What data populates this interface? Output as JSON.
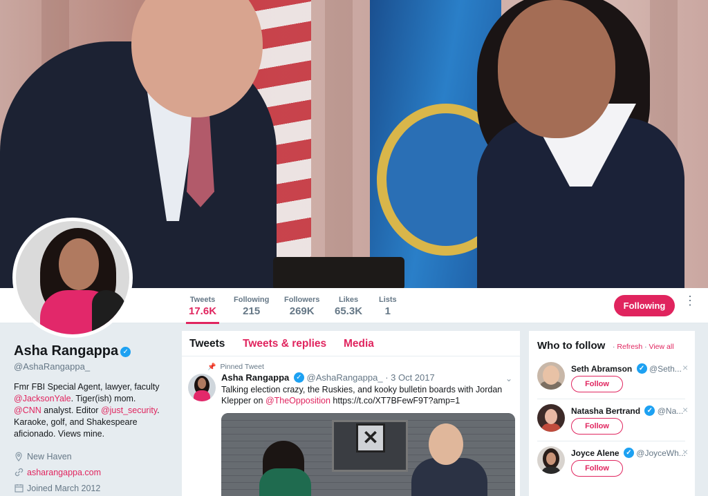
{
  "profile": {
    "name": "Asha Rangappa",
    "handle": "@AshaRangappa_",
    "bio_1": "Fmr FBI Special Agent, lawyer, faculty ",
    "bio_link_1": "@JacksonYale",
    "bio_2": ". Tiger(ish) mom. ",
    "bio_link_2": "@CNN",
    "bio_3": " analyst. Editor ",
    "bio_link_3": "@just_security",
    "bio_4": ". Karaoke, golf, and Shakespeare aficionado. Views mine.",
    "location": "New Haven",
    "website": "asharangappa.com",
    "joined": "Joined March 2012"
  },
  "stats": [
    {
      "label": "Tweets",
      "value": "17.6K"
    },
    {
      "label": "Following",
      "value": "215"
    },
    {
      "label": "Followers",
      "value": "269K"
    },
    {
      "label": "Likes",
      "value": "65.3K"
    },
    {
      "label": "Lists",
      "value": "1"
    }
  ],
  "actions": {
    "follow_label": "Following",
    "more": "⋮"
  },
  "timeline": {
    "tabs": [
      "Tweets",
      "Tweets & replies",
      "Media"
    ],
    "pinned_label": "Pinned Tweet",
    "tweet": {
      "name": "Asha Rangappa",
      "handle": "@AshaRangappa_",
      "date": "· 3 Oct 2017",
      "text_1": "Talking election crazy, the Ruskies, and kooky bulletin boards with Jordan Klepper on ",
      "text_link": "@TheOpposition",
      "text_2": " https://t.co/XT7BFewF9T?amp=1"
    }
  },
  "who_to_follow": {
    "title": "Who to follow",
    "refresh": "Refresh",
    "separator": "·",
    "view_all": "View all",
    "follow_label": "Follow",
    "suggestions": [
      {
        "name": "Seth Abramson",
        "handle": "@Seth..."
      },
      {
        "name": "Natasha Bertrand",
        "handle": "@Na..."
      },
      {
        "name": "Joyce Alene",
        "handle": "@JoyceWh..."
      }
    ]
  },
  "colors": {
    "accent": "#e0245e",
    "verified": "#1da1f2",
    "background": "#e6ecf0"
  }
}
